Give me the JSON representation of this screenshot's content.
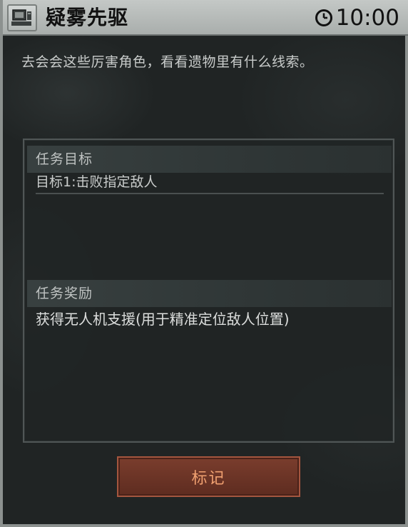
{
  "window": {
    "title": "疑雾先驱",
    "timer": "10:00"
  },
  "description": "去会会这些厉害角色，看看遗物里有什么线索。",
  "objectives": {
    "header": "任务目标",
    "items": [
      "目标1:击败指定敌人"
    ]
  },
  "rewards": {
    "header": "任务奖励",
    "text": "获得无人机支援(用于精准定位敌人位置)"
  },
  "actions": {
    "mark_label": "标记"
  },
  "icons": {
    "title_icon": "computer-terminal-icon",
    "timer_icon": "clock-icon"
  },
  "colors": {
    "accent_button": "#6b3326",
    "button_text": "#f0a070",
    "titlebar": "#b8bcba"
  }
}
